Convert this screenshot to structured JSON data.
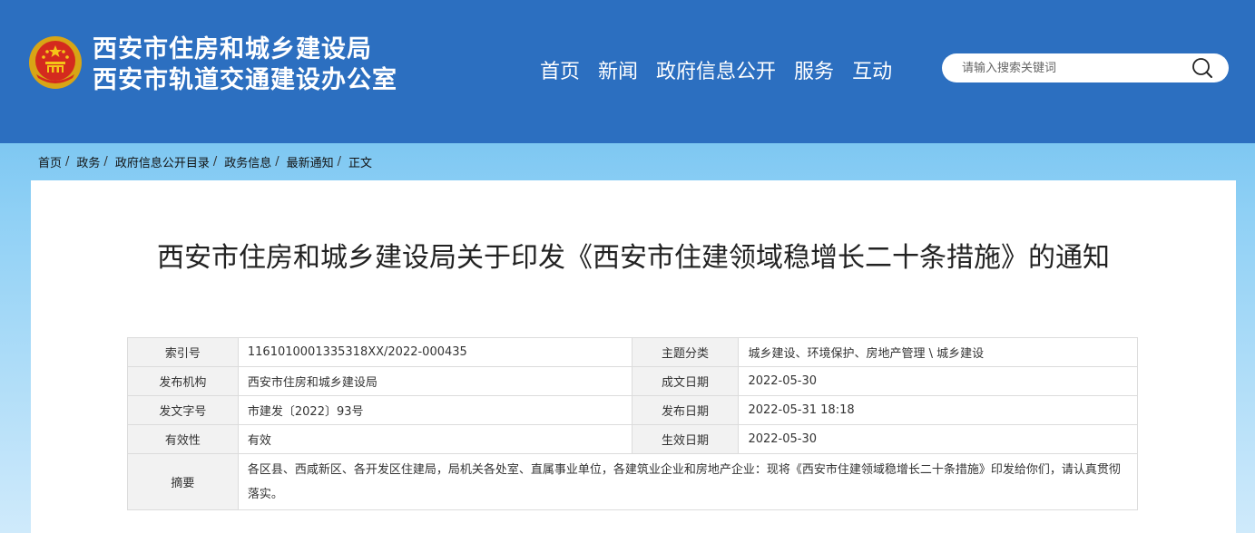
{
  "header": {
    "title_line1": "西安市住房和城乡建设局",
    "title_line2": "西安市轨道交通建设办公室",
    "emblem_icon": "national-emblem-icon",
    "bg_color": "#2c6fc0"
  },
  "nav": {
    "items": [
      {
        "label": "首页"
      },
      {
        "label": "新闻"
      },
      {
        "label": "政府信息公开"
      },
      {
        "label": "服务"
      },
      {
        "label": "互动"
      }
    ]
  },
  "search": {
    "placeholder": "请输入搜索关键词",
    "value": "",
    "icon": "search-icon"
  },
  "breadcrumb": {
    "items": [
      "首页",
      "政务",
      "政府信息公开目录",
      "政务信息",
      "最新通知",
      "正文"
    ],
    "separator": "/"
  },
  "document": {
    "title": "西安市住房和城乡建设局关于印发《西安市住建领域稳增长二十条措施》的通知",
    "meta": {
      "index_label": "索引号",
      "index_value": "1161010001335318XX/2022-000435",
      "topic_label": "主题分类",
      "topic_value": "城乡建设、环境保护、房地产管理 \\ 城乡建设",
      "publisher_label": "发布机构",
      "publisher_value": "西安市住房和城乡建设局",
      "created_label": "成文日期",
      "created_value": "2022-05-30",
      "docno_label": "发文字号",
      "docno_value": "市建发〔2022〕93号",
      "published_label": "发布日期",
      "published_value": "2022-05-31 18:18",
      "validity_label": "有效性",
      "validity_value": "有效",
      "effective_label": "生效日期",
      "effective_value": "2022-05-30",
      "abstract_label": "摘要",
      "abstract_value": "各区县、西咸新区、各开发区住建局，局机关各处室、直属事业单位，各建筑业企业和房地产企业：现将《西安市住建领域稳增长二十条措施》印发给你们，请认真贯彻落实。"
    }
  }
}
